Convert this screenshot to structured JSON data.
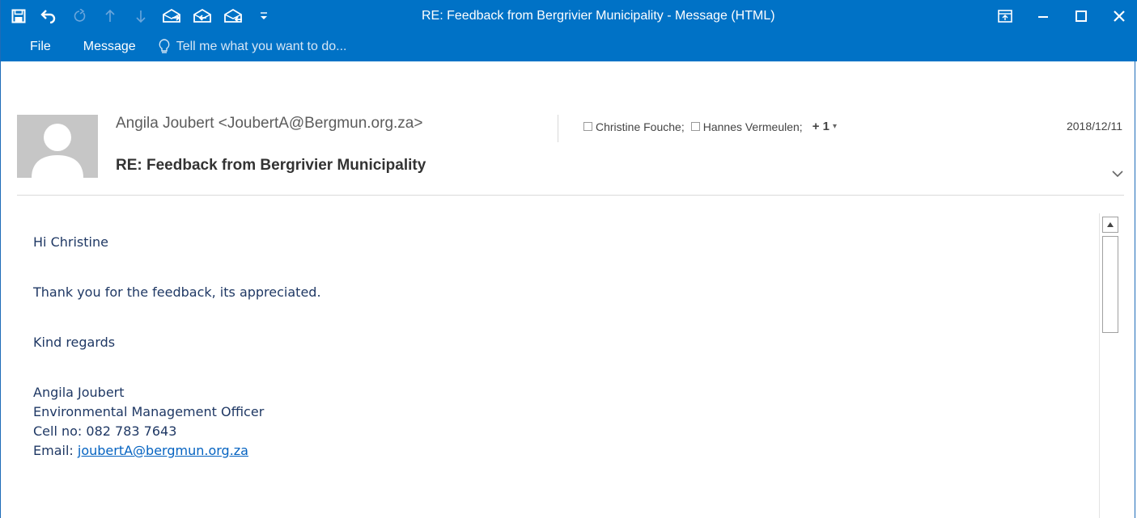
{
  "window": {
    "title": "RE: Feedback from Bergrivier Municipality - Message (HTML)"
  },
  "quick_access": {
    "icons": [
      "save-icon",
      "undo-icon",
      "redo-icon",
      "up-arrow-icon",
      "down-arrow-icon",
      "reply-icon",
      "reply-all-icon",
      "forward-icon",
      "customize-dropdown-icon"
    ]
  },
  "ribbon": {
    "tabs": [
      {
        "label": "File"
      },
      {
        "label": "Message"
      }
    ],
    "tell_me": "Tell me what you want to do..."
  },
  "message": {
    "sender": "Angila Joubert <JoubertA@Bergmun.org.za>",
    "recipients": [
      "Christine Fouche;",
      "Hannes Vermeulen;"
    ],
    "more_recipients": "+ 1",
    "date": "2018/12/11",
    "subject": "RE: Feedback from Bergrivier Municipality",
    "body": {
      "greeting": "Hi Christine",
      "line1": "Thank you for the feedback, its appreciated.",
      "closing": "Kind regards",
      "sig_name": "Angila Joubert",
      "sig_title": "Environmental Management Officer",
      "sig_cell": "Cell no: 082 783 7643",
      "sig_email_label": "Email: ",
      "sig_email_link": "joubertA@bergmun.org.za"
    }
  },
  "colors": {
    "titlebar": "#0072c6",
    "body_text": "#1f3864",
    "link": "#0563c1"
  }
}
